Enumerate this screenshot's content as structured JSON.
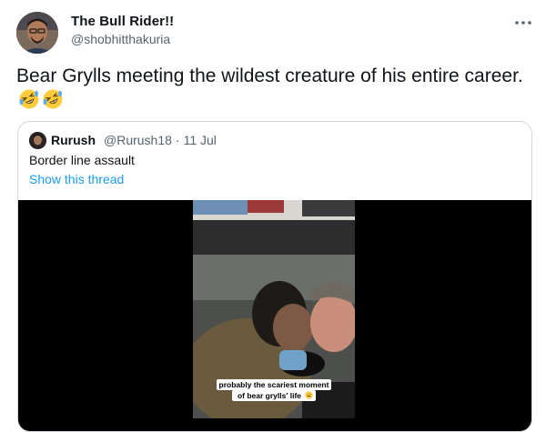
{
  "author": {
    "display_name": "The Bull Rider!!",
    "handle": "@shobhitthakuria",
    "avatar_icon": "user-avatar-photo"
  },
  "more_icon": "more-horizontal-icon",
  "tweet": {
    "text": "Bear Grylls meeting the wildest creature of his entire career.",
    "emoji": [
      "rolling-on-floor-laughing",
      "rolling-on-floor-laughing"
    ]
  },
  "quoted": {
    "display_name": "Rurush",
    "handle": "@Rurush18",
    "separator": "·",
    "date": "11 Jul",
    "text": "Border line assault",
    "show_thread": "Show this thread",
    "video_caption_line1": "probably the scariest moment",
    "video_caption_line2": "of bear grylls' life"
  },
  "colors": {
    "link": "#1d9bf0",
    "text": "#0f1419",
    "secondary": "#536471",
    "border": "#cfd9de"
  }
}
